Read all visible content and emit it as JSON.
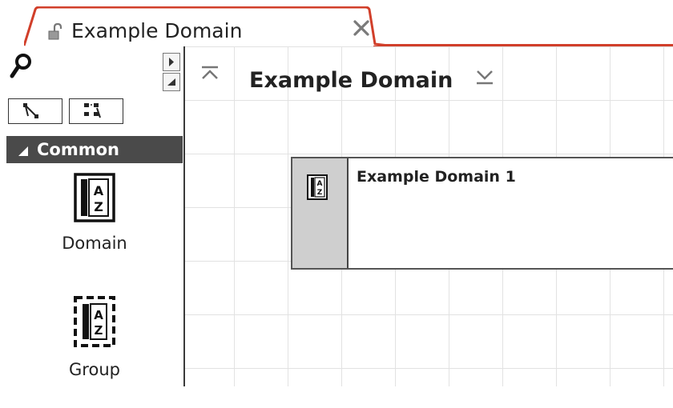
{
  "tab": {
    "title": "Example Domain",
    "lock_icon": "unlocked-lock-icon",
    "close_icon": "close-icon",
    "accent": "#d13f2a"
  },
  "toolbox": {
    "search_icon": "search-icon",
    "scroll_up_icon": "scroll-right-arrow-icon",
    "scroll_down_icon": "scroll-down-arrow-icon",
    "mode_buttons": [
      {
        "icon": "connector-tool-icon"
      },
      {
        "icon": "layout-tool-icon"
      }
    ],
    "section": {
      "label": "Common",
      "expanded": true,
      "color": "#4a4a4a"
    },
    "items": [
      {
        "label": "Domain",
        "icon": "domain-icon"
      },
      {
        "label": "Group",
        "icon": "group-icon"
      }
    ]
  },
  "canvas": {
    "title": "Example Domain",
    "collapse_icon": "collapse-all-icon",
    "expand_icon": "expand-all-icon",
    "nodes": [
      {
        "title": "Example Domain 1",
        "icon": "domain-icon"
      }
    ]
  }
}
